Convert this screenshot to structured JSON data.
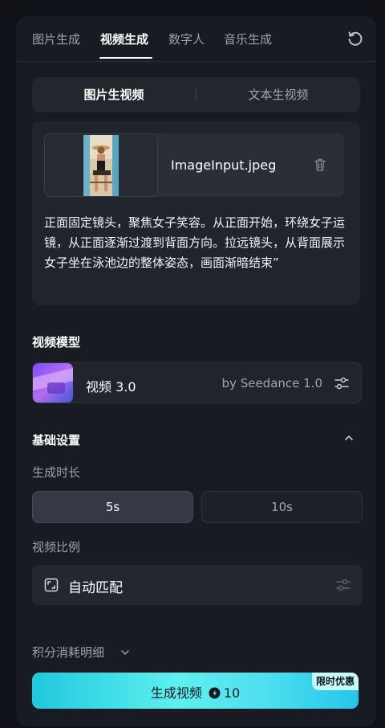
{
  "tabs": [
    {
      "label": "图片生成",
      "active": false
    },
    {
      "label": "视频生成",
      "active": true
    },
    {
      "label": "数字人",
      "active": false
    },
    {
      "label": "音乐生成",
      "active": false
    }
  ],
  "mode_switch": {
    "image_to_video": "图片生视频",
    "text_to_video": "文本生视频",
    "selected": "图片生视频"
  },
  "upload": {
    "file_name": "ImageInput.jpeg",
    "prompt": "正面固定镜头，聚焦女子笑容。从正面开始，环绕女子运镜，从正面逐渐过渡到背面方向。拉远镜头，从背面展示女子坐在泳池边的整体姿态，画面渐暗结束”"
  },
  "model_section": {
    "title": "视频模型",
    "model_name": "视频 3.0",
    "model_by": "by Seedance 1.0"
  },
  "basic_settings": {
    "title": "基础设置",
    "duration_label": "生成时长",
    "duration_options": [
      "5s",
      "10s"
    ],
    "duration_selected": "5s",
    "ratio_label": "视频比例",
    "ratio_value": "自动匹配"
  },
  "points_detail": "积分消耗明细",
  "generate": {
    "label": "生成视频",
    "cost": "10",
    "promo_badge": "限时优惠"
  },
  "colors": {
    "accent_start": "#1fc8dd",
    "accent_mid": "#5ef0ef",
    "panel_bg": "#181b22",
    "page_bg": "#0f1116"
  }
}
